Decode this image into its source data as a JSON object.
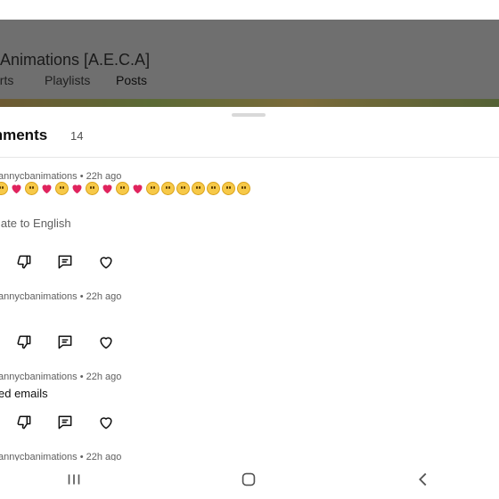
{
  "channel": {
    "title": "Animations [A.E.C.A]"
  },
  "tabs": [
    {
      "label": "orts"
    },
    {
      "label": "Playlists"
    },
    {
      "label": "Posts",
      "active": true
    }
  ],
  "sheet": {
    "title": "mments",
    "count": "14"
  },
  "comments": [
    {
      "author": "annycbanimations",
      "time": "22h ago",
      "meta": "annycbanimations • 22h ago",
      "emojis": [
        "face",
        "heart",
        "face",
        "heart",
        "face",
        "heart",
        "face",
        "heart",
        "face",
        "heart",
        "face",
        "face",
        "face",
        "face",
        "face",
        "face",
        "face"
      ],
      "translate": "late to English"
    },
    {
      "author": "annycbanimations",
      "time": "22h ago",
      "meta": "annycbanimations • 22h ago"
    },
    {
      "author": "annycbanimations",
      "time": "22h ago",
      "meta": "annycbanimations • 22h ago",
      "text": "ed emails"
    },
    {
      "author": "annycbanimations",
      "time": "22h ago",
      "meta": "annycbanimations • 22h ago"
    }
  ],
  "icons": {
    "dislike": "dislike-icon",
    "reply": "reply-icon",
    "heart": "heart-icon"
  },
  "navbar": {
    "recent": "recent-apps-icon",
    "home": "home-icon",
    "back": "back-icon"
  },
  "colors": {
    "header_overlay": "#6f6f6f",
    "heart_red": "#e0245e",
    "emoji_yellow": "#f7c948"
  }
}
